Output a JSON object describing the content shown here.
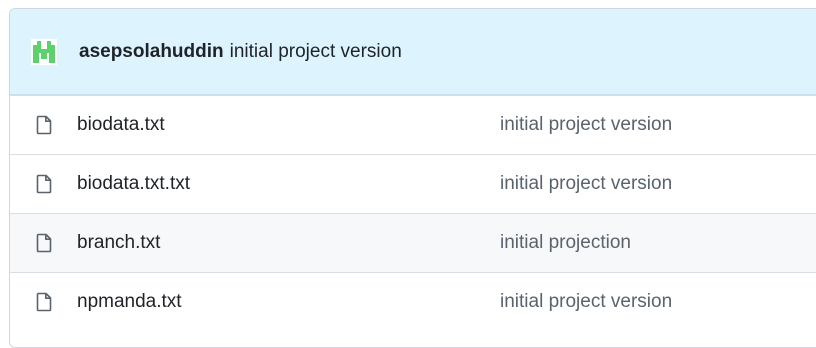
{
  "commit": {
    "author": "asepsolahuddin",
    "message": "initial project version",
    "avatar_color": "#5bd26b"
  },
  "files": [
    {
      "name": "biodata.txt",
      "icon": "file-icon",
      "commit_message": "initial project version"
    },
    {
      "name": "biodata.txt.txt",
      "icon": "file-icon",
      "commit_message": "initial project version"
    },
    {
      "name": "branch.txt",
      "icon": "file-icon",
      "commit_message": "initial projection"
    },
    {
      "name": "npmanda.txt",
      "icon": "file-icon",
      "commit_message": "initial project version"
    }
  ],
  "colors": {
    "header_bg": "#ddf4ff",
    "border": "#d0d7de",
    "muted_text": "#59636e"
  }
}
